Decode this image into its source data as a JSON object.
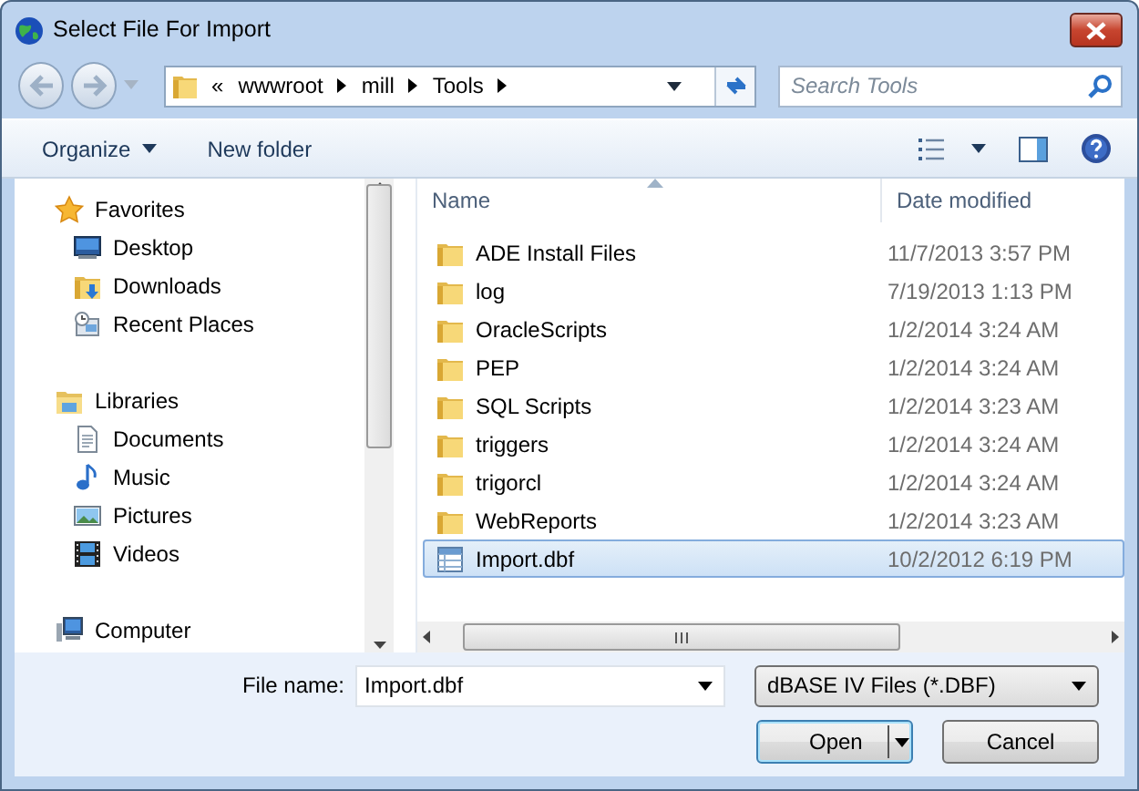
{
  "window": {
    "title": "Select File For Import"
  },
  "address": {
    "overflow": "«",
    "segments": [
      "wwwroot",
      "mill",
      "Tools"
    ]
  },
  "search": {
    "placeholder": "Search Tools"
  },
  "toolbar": {
    "organize": "Organize",
    "new_folder": "New folder"
  },
  "nav_pane": {
    "groups": [
      {
        "label": "Favorites",
        "kind": "favorites",
        "children": [
          {
            "label": "Desktop",
            "kind": "desktop"
          },
          {
            "label": "Downloads",
            "kind": "downloads"
          },
          {
            "label": "Recent Places",
            "kind": "recent"
          }
        ]
      },
      {
        "label": "Libraries",
        "kind": "libraries",
        "children": [
          {
            "label": "Documents",
            "kind": "documents"
          },
          {
            "label": "Music",
            "kind": "music"
          },
          {
            "label": "Pictures",
            "kind": "pictures"
          },
          {
            "label": "Videos",
            "kind": "videos"
          }
        ]
      },
      {
        "label": "Computer",
        "kind": "computer"
      }
    ]
  },
  "file_list": {
    "columns": [
      "Name",
      "Date modified"
    ],
    "rows": [
      {
        "name": "ADE Install Files",
        "date": "11/7/2013 3:57 PM",
        "kind": "folder",
        "selected": false
      },
      {
        "name": "log",
        "date": "7/19/2013 1:13 PM",
        "kind": "folder",
        "selected": false
      },
      {
        "name": "OracleScripts",
        "date": "1/2/2014 3:24 AM",
        "kind": "folder",
        "selected": false
      },
      {
        "name": "PEP",
        "date": "1/2/2014 3:24 AM",
        "kind": "folder",
        "selected": false
      },
      {
        "name": "SQL Scripts",
        "date": "1/2/2014 3:23 AM",
        "kind": "folder",
        "selected": false
      },
      {
        "name": "triggers",
        "date": "1/2/2014 3:24 AM",
        "kind": "folder",
        "selected": false
      },
      {
        "name": "trigorcl",
        "date": "1/2/2014 3:24 AM",
        "kind": "folder",
        "selected": false
      },
      {
        "name": "WebReports",
        "date": "1/2/2014 3:23 AM",
        "kind": "folder",
        "selected": false
      },
      {
        "name": "Import.dbf",
        "date": "10/2/2012 6:19 PM",
        "kind": "file",
        "selected": true
      }
    ]
  },
  "footer": {
    "file_name_label": "File name:",
    "file_name": "Import.dbf",
    "file_type": "dBASE IV Files (*.DBF)",
    "buttons": [
      {
        "label": "Open",
        "kind": "split"
      },
      {
        "label": "Cancel",
        "kind": "plain"
      }
    ]
  }
}
